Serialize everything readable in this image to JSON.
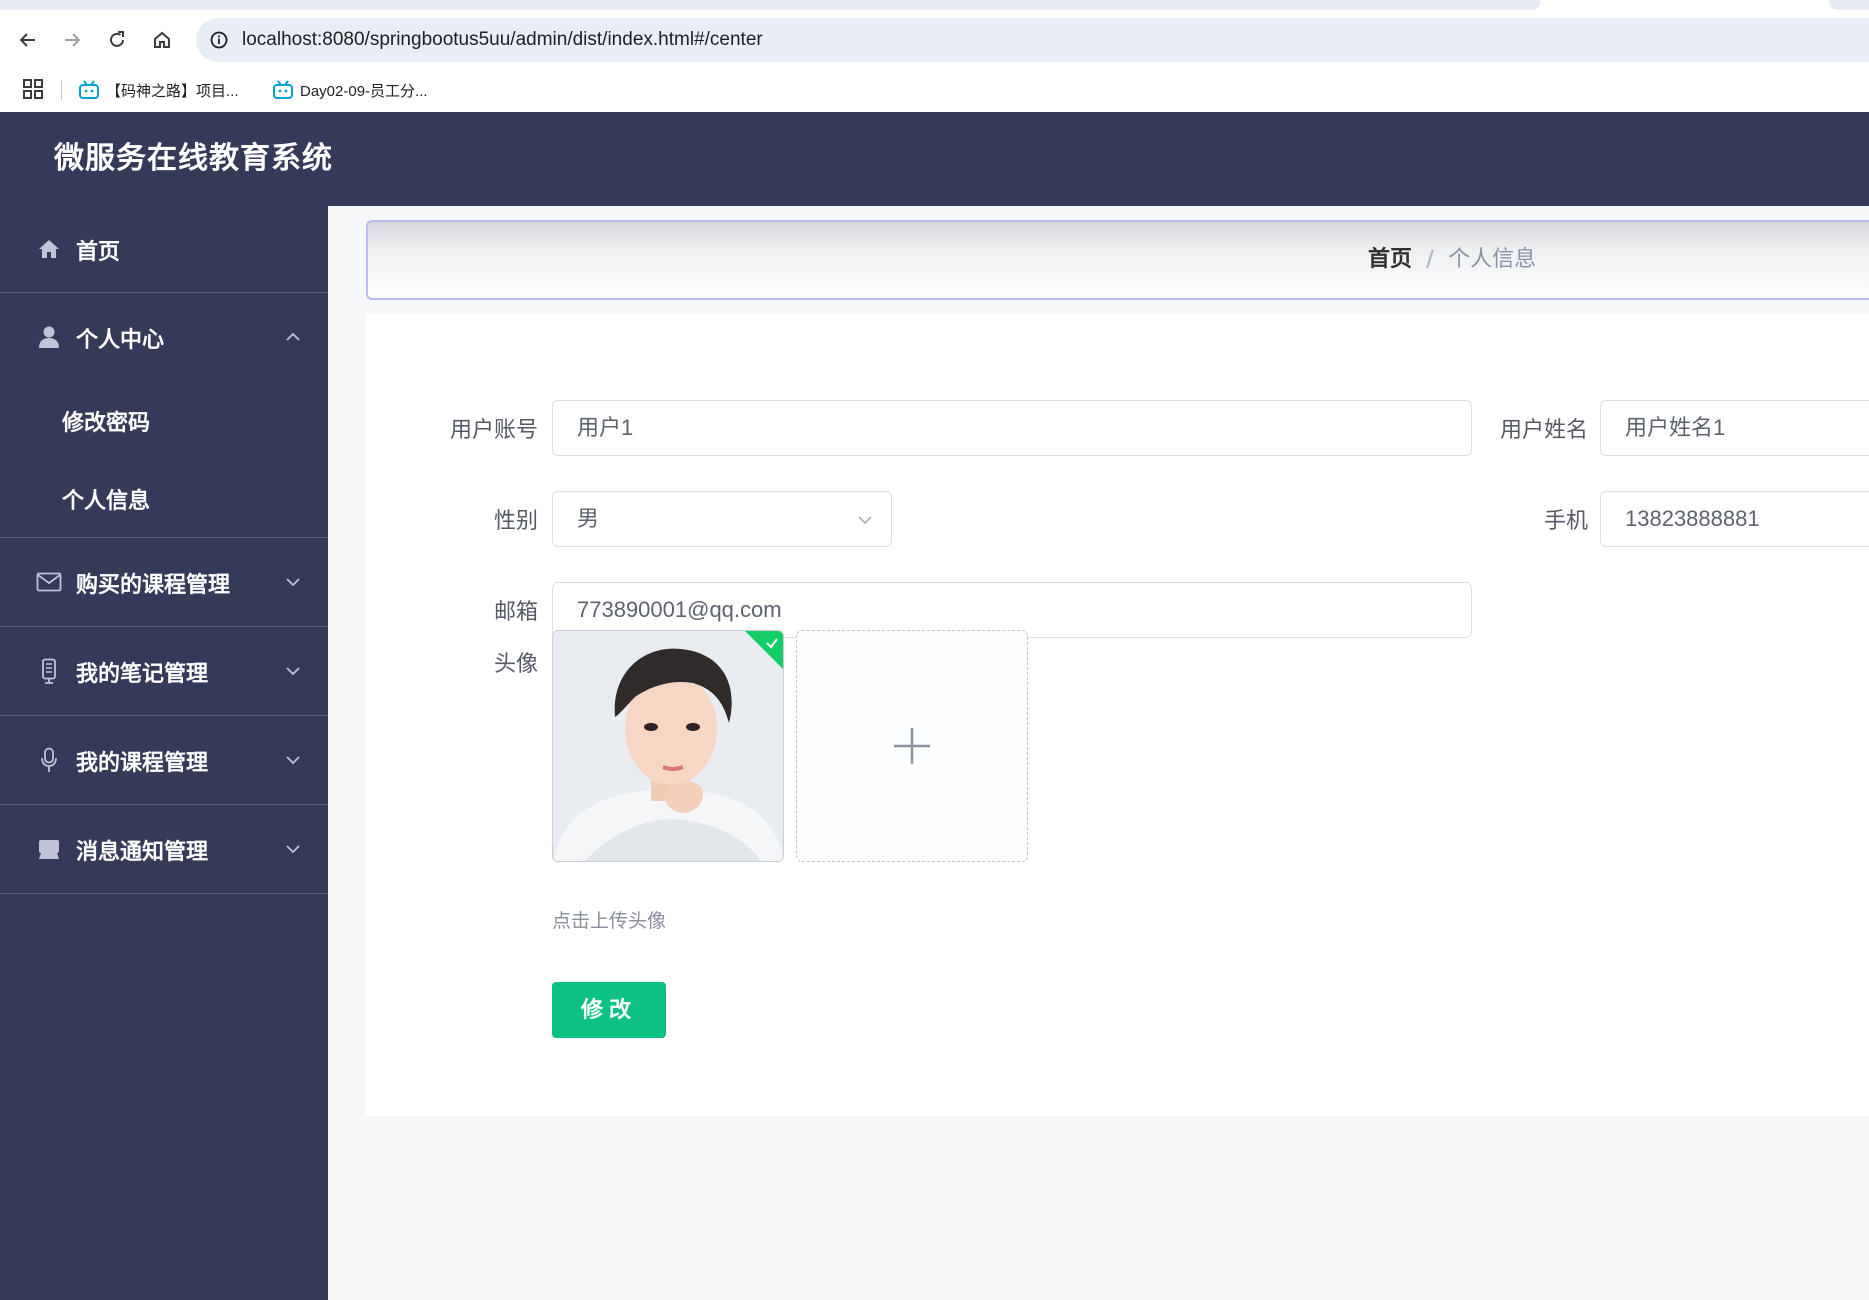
{
  "browser": {
    "url": "localhost:8080/springbootus5uu/admin/dist/index.html#/center",
    "bookmarks": [
      {
        "label": "【码神之路】项目..."
      },
      {
        "label": "Day02-09-员工分..."
      }
    ]
  },
  "app": {
    "title": "微服务在线教育系统"
  },
  "sidebar": {
    "items": [
      {
        "label": "首页",
        "icon": "home-icon"
      },
      {
        "label": "个人中心",
        "icon": "user-icon",
        "expanded": true,
        "children": [
          {
            "label": "修改密码"
          },
          {
            "label": "个人信息"
          }
        ]
      },
      {
        "label": "购买的课程管理",
        "icon": "mail-icon"
      },
      {
        "label": "我的笔记管理",
        "icon": "notebook-icon"
      },
      {
        "label": "我的课程管理",
        "icon": "microphone-icon"
      },
      {
        "label": "消息通知管理",
        "icon": "inbox-icon"
      }
    ]
  },
  "breadcrumb": {
    "home": "首页",
    "separator": "/",
    "current": "个人信息"
  },
  "form": {
    "account_label": "用户账号",
    "account_value": "用户1",
    "name_label": "用户姓名",
    "name_value": "用户姓名1",
    "gender_label": "性别",
    "gender_value": "男",
    "phone_label": "手机",
    "phone_value": "13823888881",
    "email_label": "邮箱",
    "email_value": "773890001@qq.com",
    "avatar_label": "头像",
    "upload_hint": "点击上传头像",
    "submit_label": "修改"
  },
  "colors": {
    "sidebar_bg": "#363a59",
    "accent_green": "#0dc185",
    "success_badge": "#13ce66"
  }
}
